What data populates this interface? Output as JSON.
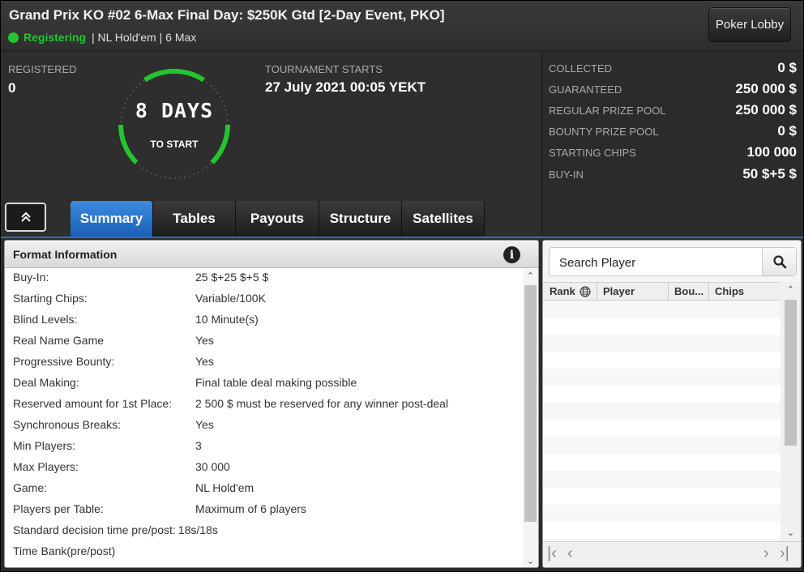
{
  "window": {
    "title": "Grand Prix KO #02 6-Max Final Day: $250K Gtd [2-Day Event, PKO]",
    "status": "Registering",
    "meta": "| NL Hold'em | 6 Max",
    "lobby_button": "Poker Lobby"
  },
  "colors": {
    "status": "#22c52e",
    "accent": "#2a6fc4",
    "ring": "#22c52e"
  },
  "header": {
    "registered_label": "REGISTERED",
    "registered_value": "0",
    "starts_label": "TOURNAMENT STARTS",
    "starts_value": "27 July 2021  00:05 YEKT",
    "countdown": "8 DAYS",
    "countdown_sub": "TO START"
  },
  "stats": [
    {
      "label": "COLLECTED",
      "value": "0 $"
    },
    {
      "label": "GUARANTEED",
      "value": "250 000 $"
    },
    {
      "label": "REGULAR PRIZE POOL",
      "value": "250 000 $"
    },
    {
      "label": "BOUNTY PRIZE POOL",
      "value": "0 $"
    },
    {
      "label": "STARTING CHIPS",
      "value": "100 000"
    },
    {
      "label": "BUY-IN",
      "value": "50 $+5 $"
    }
  ],
  "tabs": [
    "Summary",
    "Tables",
    "Payouts",
    "Structure",
    "Satellites"
  ],
  "active_tab": "Summary",
  "format": {
    "title": "Format Information",
    "rows": [
      {
        "key": "Buy-In:",
        "value": "25 $+25 $+5 $"
      },
      {
        "key": "Starting Chips:",
        "value": "Variable/100K"
      },
      {
        "key": "Blind Levels:",
        "value": "10 Minute(s)"
      },
      {
        "key": "Real Name Game",
        "value": "Yes"
      },
      {
        "key": "Progressive Bounty:",
        "value": "Yes"
      },
      {
        "key": "Deal Making:",
        "value": "Final table deal making possible"
      },
      {
        "key": "Reserved amount for 1st Place:",
        "value": "2 500 $ must be reserved for any winner post-deal"
      },
      {
        "key": "Synchronous Breaks:",
        "value": "Yes"
      },
      {
        "key": "Min Players:",
        "value": "3"
      },
      {
        "key": "Max Players:",
        "value": "30 000"
      },
      {
        "key": "Game:",
        "value": "NL Hold'em"
      },
      {
        "key": "Players per Table:",
        "value": "Maximum of 6 players"
      },
      {
        "key": "Standard decision time pre/post:",
        "value": "18s/18s"
      },
      {
        "key": "Time Bank(pre/post)",
        "value": ""
      }
    ]
  },
  "players": {
    "search_placeholder": "Search Player",
    "columns": [
      "Rank",
      "Player",
      "Bou...",
      "Chips"
    ],
    "empty_rows": 14
  }
}
